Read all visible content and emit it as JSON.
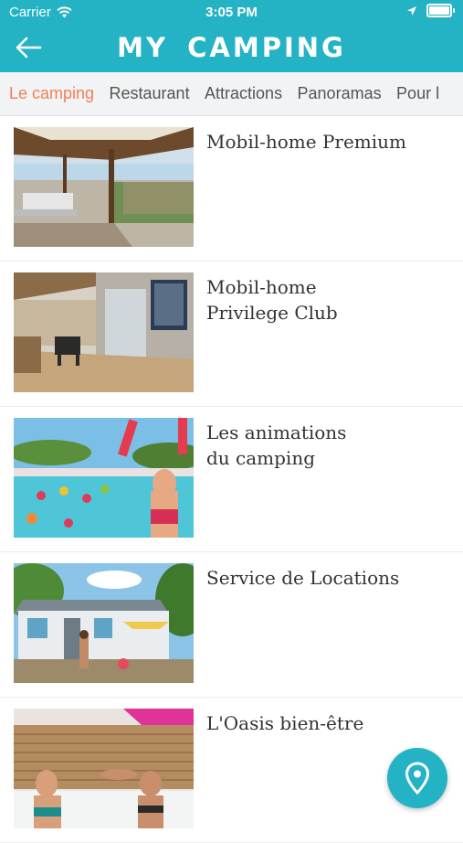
{
  "status": {
    "carrier": "Carrier",
    "time": "3:05 PM"
  },
  "header": {
    "title": "MY CAMPING"
  },
  "tabs": [
    {
      "label": "Le camping",
      "active": true
    },
    {
      "label": "Restaurant"
    },
    {
      "label": "Attractions"
    },
    {
      "label": "Panoramas"
    },
    {
      "label": "Pour l"
    }
  ],
  "items": [
    {
      "title": "Mobil-home Premium"
    },
    {
      "title": "Mobil-home\nPrivilege Club"
    },
    {
      "title": "Les animations\ndu camping"
    },
    {
      "title": "Service de Locations"
    },
    {
      "title": "L'Oasis bien-être"
    }
  ],
  "colors": {
    "accent": "#24b3c4",
    "active_tab": "#f0805a"
  }
}
